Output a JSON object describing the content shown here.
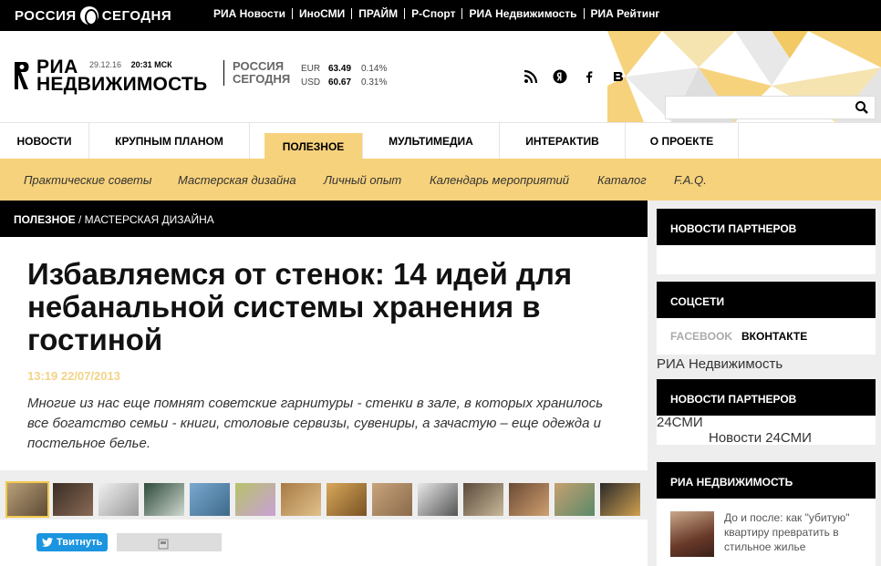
{
  "topbar": {
    "brand": "РОССИЯ СЕГОДНЯ",
    "links": [
      "РИА Новости",
      "ИноСМИ",
      "ПРАЙМ",
      "Р-Спорт",
      "РИА Недвижимость",
      "РИА Рейтинг"
    ]
  },
  "header": {
    "logo_line1": "РИА",
    "logo_line2": "НЕДВИЖИМОСТЬ",
    "date": "29.12.16",
    "time": "20:31 МСК",
    "rs_line1": "РОССИЯ",
    "rs_line2": "СЕГОДНЯ",
    "rates": [
      {
        "currency": "EUR",
        "value": "63.49",
        "change": "0.14%"
      },
      {
        "currency": "USD",
        "value": "60.67",
        "change": "0.31%"
      }
    ],
    "socials": [
      "rss-icon",
      "yandex-icon",
      "facebook-icon",
      "vkontakte-icon"
    ],
    "search_placeholder": ""
  },
  "nav": {
    "items": [
      "НОВОСТИ",
      "КРУПНЫМ ПЛАНОМ",
      "ПОЛЕЗНОЕ",
      "МУЛЬТИМЕДИА",
      "ИНТЕРАКТИВ",
      "О ПРОЕКТЕ"
    ],
    "active": "ПОЛЕЗНОЕ"
  },
  "subnav": {
    "items": [
      "Практические советы",
      "Мастерская дизайна",
      "Личный опыт",
      "Календарь мероприятий",
      "Каталог",
      "F.A.Q."
    ]
  },
  "breadcrumb": {
    "section": "ПОЛЕЗНОЕ",
    "separator": " / ",
    "subsection": "МАСТЕРСКАЯ ДИЗАЙНА"
  },
  "article": {
    "title": "Избавляемся от стенок: 14 идей для небанальной системы хранения в гостиной",
    "time": "13:19 22/07/2013",
    "lead": "Многие из нас еще помнят советские гарнитуры - стенки в зале, в которых хранилось все богатство семьи - книги, столовые сервизы, сувениры, а зачастую – еще одежда и постельное белье.",
    "tweet_label": "Твитнуть"
  },
  "sidebar": {
    "partners_title": "НОВОСТИ ПАРТНЕРОВ",
    "socials_title": "СОЦСЕТИ",
    "tab_facebook": "FACEBOOK",
    "tab_vk": "ВКОНТАКТЕ",
    "ria_text": "РИА Недвижимость",
    "partners2_title": "НОВОСТИ ПАРТНЕРОВ",
    "smi_label": "24СМИ",
    "smi_news": "Новости 24СМИ",
    "ria_title": "РИА НЕДВИЖИМОСТЬ",
    "ria_news": "До и после: как \"убитую\" квартиру превратить в стильное жилье"
  },
  "colors": {
    "accent": "#f7d27c",
    "black": "#000000",
    "twitter": "#1b95e0",
    "time": "#f2d487"
  }
}
